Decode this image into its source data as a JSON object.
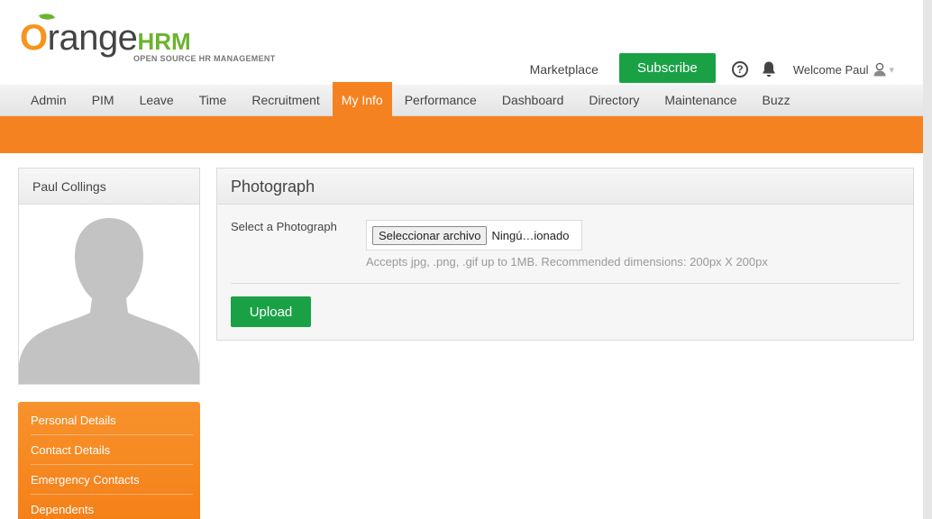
{
  "brand": {
    "logo_word": "range",
    "logo_o": "O",
    "logo_hrm": "HRM",
    "tagline": "OPEN SOURCE HR MANAGEMENT",
    "colors": {
      "orange": "#f58220",
      "green": "#6cb32e",
      "button_green": "#1aa146"
    }
  },
  "header": {
    "marketplace": "Marketplace",
    "subscribe": "Subscribe",
    "help_icon": "?",
    "welcome": "Welcome Paul",
    "caret": "▾"
  },
  "nav": {
    "items": [
      "Admin",
      "PIM",
      "Leave",
      "Time",
      "Recruitment",
      "My Info",
      "Performance",
      "Dashboard",
      "Directory",
      "Maintenance",
      "Buzz"
    ],
    "active": "My Info"
  },
  "profile": {
    "name": "Paul Collings"
  },
  "side_menu": {
    "items": [
      "Personal Details",
      "Contact Details",
      "Emergency Contacts",
      "Dependents"
    ]
  },
  "photo_panel": {
    "title": "Photograph",
    "field_label": "Select a Photograph",
    "file_button": "Seleccionar archivo",
    "file_status": "Ningú…ionado",
    "hint": "Accepts jpg, .png, .gif up to 1MB. Recommended dimensions: 200px X 200px",
    "upload": "Upload"
  }
}
